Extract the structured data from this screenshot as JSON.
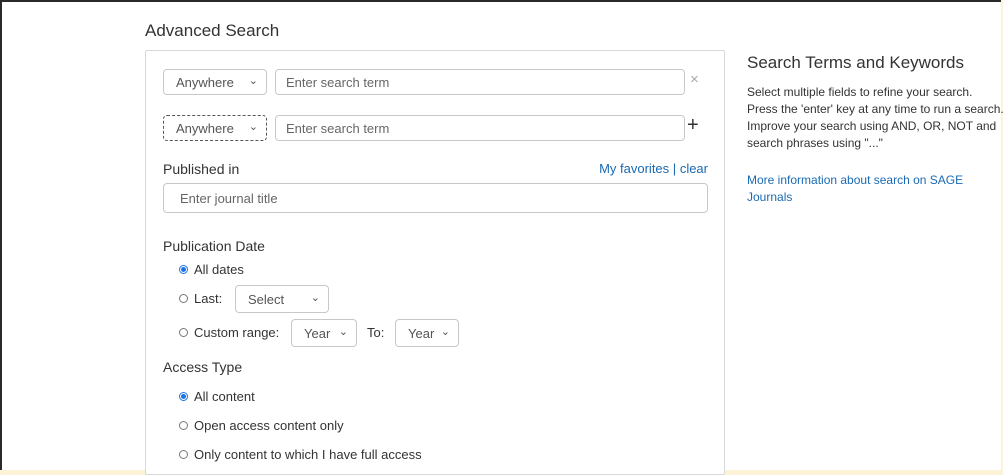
{
  "page_title": "Advanced Search",
  "search_rows": [
    {
      "field": "Anywhere",
      "placeholder": "Enter search term",
      "action_icon": "close-icon",
      "action_glyph": "×"
    },
    {
      "field": "Anywhere",
      "placeholder": "Enter search term",
      "action_icon": "plus-icon",
      "action_glyph": "+"
    }
  ],
  "published_in": {
    "label": "Published in",
    "favorites_link": "My favorites",
    "separator": "|",
    "clear_link": "clear",
    "placeholder": "Enter journal title"
  },
  "publication_date": {
    "label": "Publication Date",
    "all_dates": "All dates",
    "last_label": "Last:",
    "last_select": "Select",
    "custom_label": "Custom range:",
    "from_select": "Year",
    "to_label": "To:",
    "to_select": "Year",
    "selected": "all_dates"
  },
  "access_type": {
    "label": "Access Type",
    "options": [
      "All content",
      "Open access content only",
      "Only content to which I have full access"
    ],
    "selected": 0
  },
  "sidebar": {
    "title": "Search Terms and Keywords",
    "body": "Select multiple fields to refine your search. Press the 'enter' key at any time to run a search. Improve your search using AND, OR, NOT and search phrases using \"...\"",
    "link": "More information about search on SAGE Journals"
  },
  "colors": {
    "accent": "#1a73e8",
    "link": "#1a6ab3",
    "outer_background": "#fcf3d9"
  }
}
